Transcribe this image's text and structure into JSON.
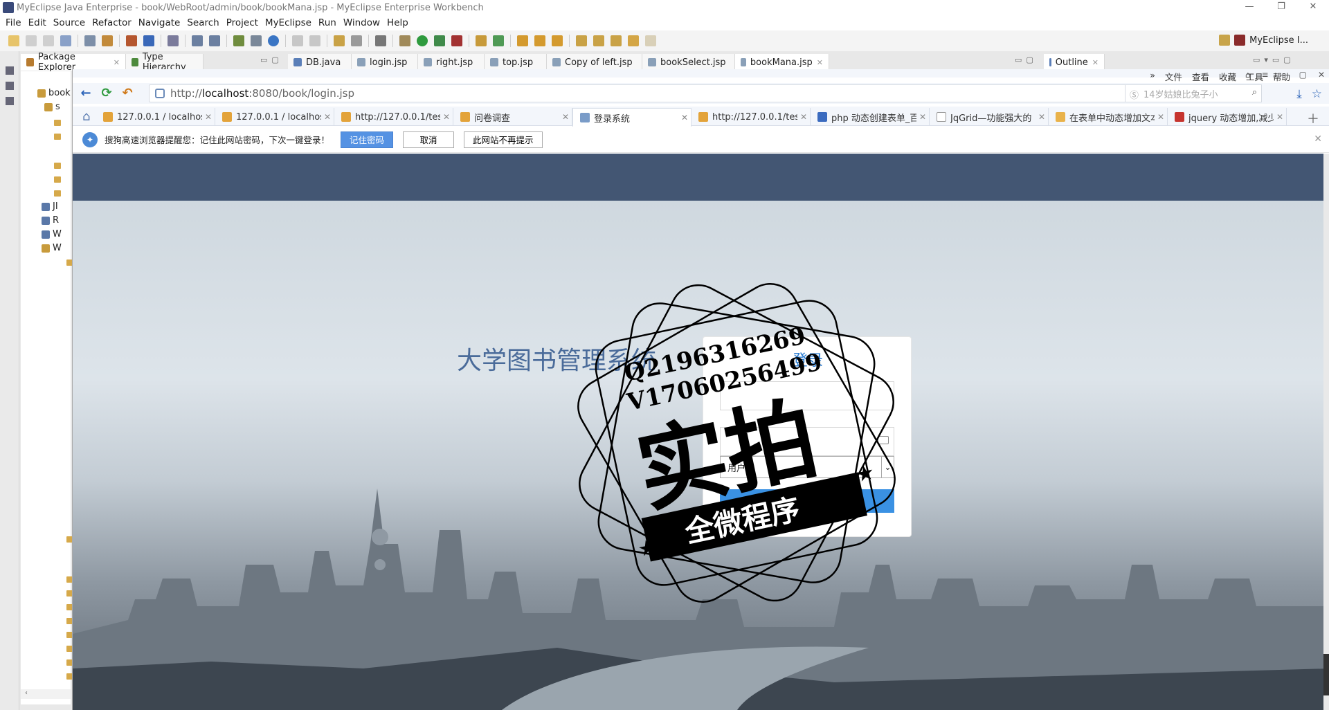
{
  "window": {
    "title": "MyEclipse Java Enterprise - book/WebRoot/admin/book/bookMana.jsp - MyEclipse Enterprise Workbench",
    "controls": [
      "—",
      "❐",
      "✕"
    ]
  },
  "menu": [
    "File",
    "Edit",
    "Source",
    "Refactor",
    "Navigate",
    "Search",
    "Project",
    "MyEclipse",
    "Run",
    "Window",
    "Help"
  ],
  "perspective_label": "MyEclipse I...",
  "views": {
    "package_explorer": "Package Explorer",
    "type_hierarchy": "Type Hierarchy",
    "outline": "Outline"
  },
  "editor_tabs": [
    "DB.java",
    "login.jsp",
    "right.jsp",
    "top.jsp",
    "Copy of left.jsp",
    "bookSelect.jsp",
    "bookMana.jsp"
  ],
  "package_tree": {
    "root": "book",
    "rows": [
      "s",
      "JI",
      "R",
      "W",
      "W"
    ]
  },
  "browser": {
    "menus": [
      "文件",
      "查看",
      "收藏",
      "工具",
      "帮助"
    ],
    "url_prefix": "http://",
    "url_host": "localhost",
    "url_rest": ":8080/book/login.jsp",
    "search_placeholder": "14岁姑娘比兔子小",
    "tabs": [
      "127.0.0.1 / localhost",
      "127.0.0.1 / localhost",
      "http://127.0.0.1/test",
      "问卷调查",
      "登录系统",
      "http://127.0.0.1/test",
      "php 动态创建表单_百",
      "JqGrid—功能强大的",
      "在表单中动态增加文本",
      "jquery 动态增加,减少"
    ],
    "active_tab_index": 4,
    "password_bar": {
      "message": "搜狗高速浏览器提醒您：记住此网站密码，下次一键登录！",
      "remember": "记住密码",
      "cancel": "取消",
      "never": "此网站不再提示"
    }
  },
  "login_page": {
    "system_title": "大学图书管理系统",
    "heading": "登录",
    "username_value": "",
    "password_value": "",
    "role_selected": "用户",
    "submit": "登录"
  },
  "watermark": {
    "line1": "Q2196316269",
    "line2": "V17060256499",
    "big": "实拍",
    "banner": "全微程序"
  },
  "colors": {
    "page_header": "#435673",
    "login_button": "#3a91e3",
    "heading_blue": "#2a7bd0"
  }
}
